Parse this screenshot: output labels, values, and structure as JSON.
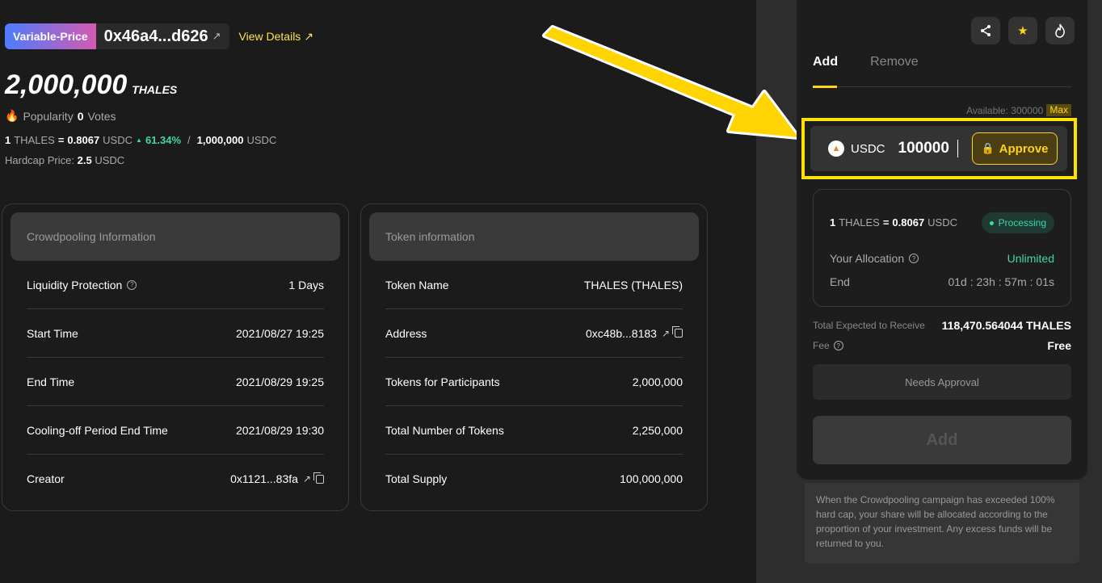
{
  "header": {
    "badge": "Variable-Price",
    "address": "0x46a4...d626",
    "view_details": "View Details"
  },
  "summary": {
    "amount": "2,000,000",
    "symbol": "THALES",
    "popularity_label": "Popularity",
    "popularity_count": "0",
    "votes_label": "Votes",
    "price_one": "1",
    "price_token": "THALES",
    "price_eq": "=",
    "price_value": "0.8067",
    "price_unit": "USDC",
    "price_change": "61.34%",
    "price_sep": "/",
    "cap_value": "1,000,000",
    "cap_unit": "USDC",
    "hardcap_label": "Hardcap Price:",
    "hardcap_value": "2.5",
    "hardcap_unit": "USDC"
  },
  "crowdpooling": {
    "title": "Crowdpooling Information",
    "rows": [
      {
        "label": "Liquidity Protection",
        "value": "1 Days"
      },
      {
        "label": "Start Time",
        "value": "2021/08/27 19:25"
      },
      {
        "label": "End Time",
        "value": "2021/08/29 19:25"
      },
      {
        "label": "Cooling-off Period End Time",
        "value": "2021/08/29 19:30"
      },
      {
        "label": "Creator",
        "value": "0x1121...83fa"
      }
    ]
  },
  "token_info": {
    "title": "Token information",
    "rows": [
      {
        "label": "Token Name",
        "value": "THALES (THALES)"
      },
      {
        "label": "Address",
        "value": "0xc48b...8183"
      },
      {
        "label": "Tokens for Participants",
        "value": "2,000,000"
      },
      {
        "label": "Total Number of Tokens",
        "value": "2,250,000"
      },
      {
        "label": "Total Supply",
        "value": "100,000,000"
      }
    ]
  },
  "panel": {
    "tabs": {
      "add": "Add",
      "remove": "Remove"
    },
    "available_label": "Available: 300000",
    "max_label": "Max",
    "coin": "USDC",
    "amount_value": "100000",
    "approve_label": "Approve",
    "rate_one": "1",
    "rate_token": "THALES",
    "rate_eq": "=",
    "rate_value": "0.8067",
    "rate_unit": "USDC",
    "status": "Processing",
    "allocation_label": "Your Allocation",
    "allocation_value": "Unlimited",
    "end_label": "End",
    "end_value": "01d : 23h : 57m : 01s",
    "receive_label": "Total Expected to Receive",
    "receive_value": "118,470.564044 THALES",
    "fee_label": "Fee",
    "fee_value": "Free",
    "needs_approval": "Needs Approval",
    "add_button": "Add",
    "notice": "When the Crowdpooling campaign has exceeded 100% hard cap, your share will be allocated according to the proportion of your investment. Any excess funds will be returned to you."
  },
  "colors": {
    "accent": "#ffd31a",
    "positive": "#3dd8a4",
    "highlight_frame": "#ffe100",
    "fire": "#ff6a2b"
  }
}
